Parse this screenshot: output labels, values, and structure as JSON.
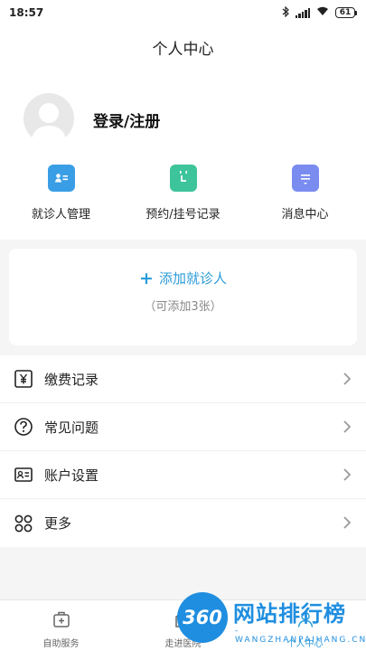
{
  "status_bar": {
    "time": "18:57",
    "battery": "61",
    "icons": [
      "bluetooth-icon",
      "signal-icon",
      "wifi-icon",
      "battery-icon"
    ]
  },
  "header": {
    "title": "个人中心"
  },
  "profile": {
    "login_label": "登录/注册"
  },
  "quick_actions": [
    {
      "label": "就诊人管理",
      "icon": "patient-card-icon",
      "color": "#3a9ee6"
    },
    {
      "label": "预约/挂号记录",
      "icon": "calendar-icon",
      "color": "#3ec49a"
    },
    {
      "label": "消息中心",
      "icon": "message-icon",
      "color": "#7a8cf0"
    }
  ],
  "add_patient": {
    "plus": "+",
    "label": "添加就诊人",
    "hint": "（可添加3张）"
  },
  "menu": [
    {
      "label": "缴费记录",
      "icon": "yuan-receipt-icon"
    },
    {
      "label": "常见问题",
      "icon": "question-icon"
    },
    {
      "label": "账户设置",
      "icon": "account-card-icon"
    },
    {
      "label": "更多",
      "icon": "grid-more-icon"
    }
  ],
  "bottom_nav": [
    {
      "label": "自助服务",
      "icon": "medical-kit-icon"
    },
    {
      "label": "走进医院",
      "icon": "hospital-icon"
    },
    {
      "label": "个人中心",
      "icon": "person-icon"
    }
  ],
  "watermark": {
    "badge": "360",
    "name": "网站排行榜",
    "url": "-WANGZHANPAIHANG.CN-"
  },
  "colors": {
    "accent": "#2b9cd8",
    "background": "#f5f5f5"
  }
}
